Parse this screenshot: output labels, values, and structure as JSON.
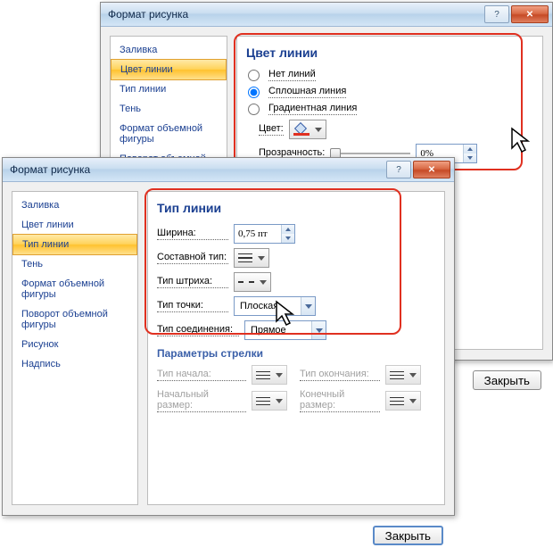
{
  "dialog1": {
    "title": "Формат рисунка",
    "nav": [
      "Заливка",
      "Цвет линии",
      "Тип линии",
      "Тень",
      "Формат объемной фигуры",
      "Поворот объемной фигуры"
    ],
    "selectedIndex": 1,
    "pane": {
      "title": "Цвет линии",
      "opt_none": "Нет линий",
      "opt_solid": "Сплошная линия",
      "opt_grad": "Градиентная линия",
      "color_label": "Цвет:",
      "opacity_label": "Прозрачность:",
      "opacity_value": "0%"
    },
    "close_btn": "Закрыть"
  },
  "dialog2": {
    "title": "Формат рисунка",
    "nav": [
      "Заливка",
      "Цвет линии",
      "Тип линии",
      "Тень",
      "Формат объемной фигуры",
      "Поворот объемной фигуры",
      "Рисунок",
      "Надпись"
    ],
    "selectedIndex": 2,
    "pane": {
      "title": "Тип линии",
      "width_label": "Ширина:",
      "width_value": "0,75 пт",
      "compound_label": "Составной тип:",
      "dash_label": "Тип штриха:",
      "cap_label": "Тип точки:",
      "cap_value": "Плоская",
      "join_label": "Тип соединения:",
      "join_value": "Прямое",
      "arrows_title": "Параметры стрелки",
      "begin_type": "Тип начала:",
      "end_type": "Тип окончания:",
      "begin_size": "Начальный размер:",
      "end_size": "Конечный размер:"
    },
    "close_btn": "Закрыть"
  }
}
